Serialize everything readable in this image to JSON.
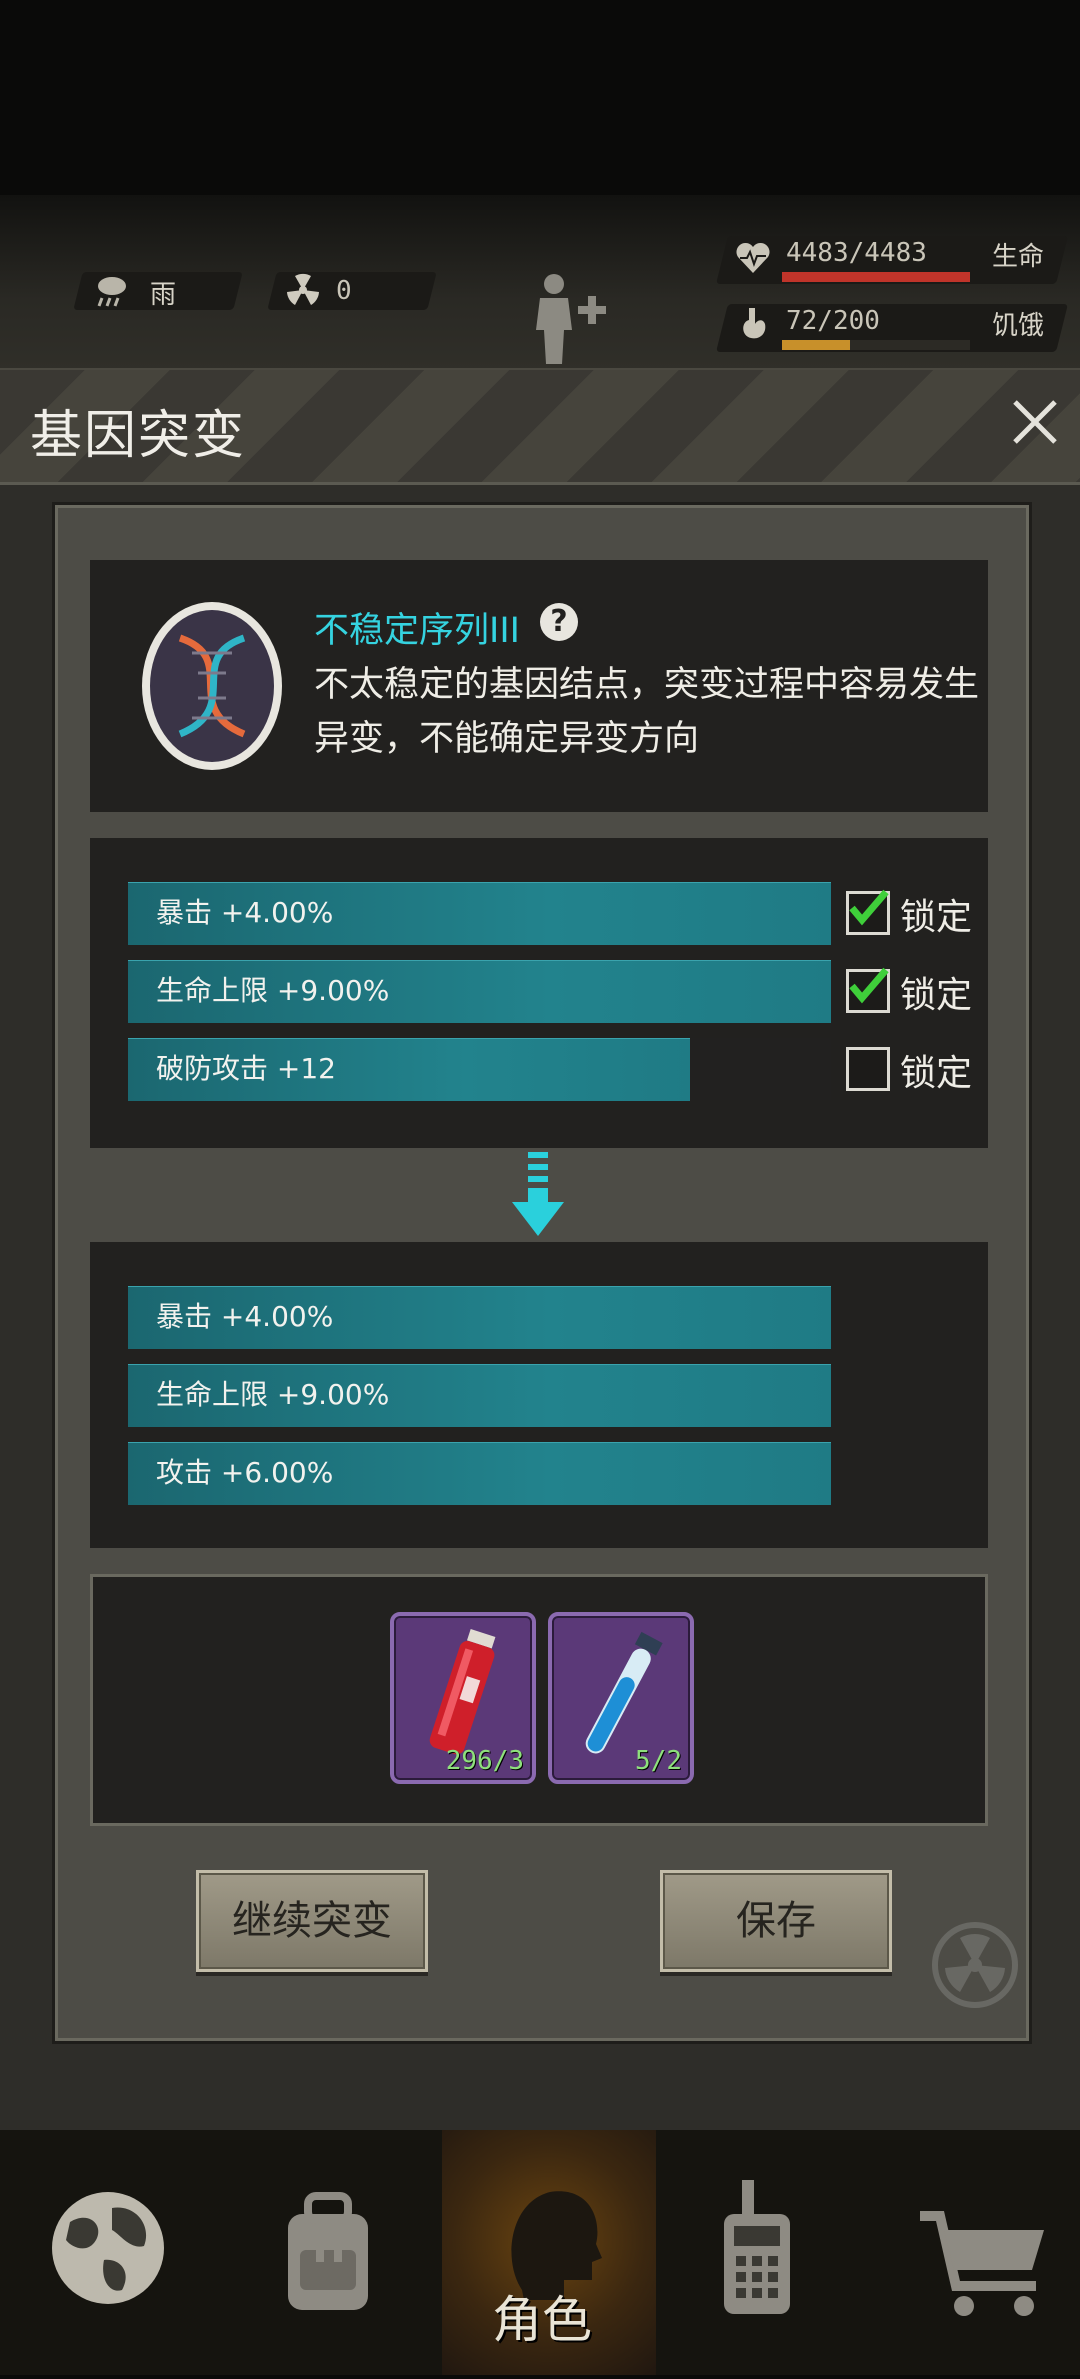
{
  "hud": {
    "weather_label": "雨",
    "weather_icon": "rain-cloud-icon",
    "radiation_value": "0",
    "radiation_icon": "radiation-icon",
    "health_text": "4483/4483",
    "health_label": "生命",
    "health_fraction": 1.0,
    "hunger_text": "72/200",
    "hunger_label": "饥饿",
    "hunger_fraction": 0.36,
    "colors": {
      "health": "#c0342a",
      "hunger": "#c8902a"
    }
  },
  "dialog": {
    "title": "基因突变",
    "gene": {
      "name": "不稳定序列III",
      "description": "不太稳定的基因结点，突变过程中容易发生异变，不能确定异变方向"
    },
    "current_stats": [
      {
        "text": "暴击 +4.00%",
        "fill": 1.0,
        "locked": true,
        "lock_label": "锁定"
      },
      {
        "text": "生命上限 +9.00%",
        "fill": 1.0,
        "locked": true,
        "lock_label": "锁定"
      },
      {
        "text": "破防攻击 +12",
        "fill": 0.8,
        "locked": false,
        "lock_label": "锁定"
      }
    ],
    "result_stats": [
      {
        "text": "暴击 +4.00%",
        "fill": 1.0
      },
      {
        "text": "生命上限 +9.00%",
        "fill": 1.0
      },
      {
        "text": "攻击 +6.00%",
        "fill": 1.0
      }
    ],
    "items": [
      {
        "name": "red-vial-icon",
        "count": "296/3"
      },
      {
        "name": "blue-test-tube-icon",
        "count": "5/2"
      }
    ],
    "continue_button": "继续突变",
    "save_button": "保存"
  },
  "nav": {
    "items": [
      {
        "icon": "globe-icon"
      },
      {
        "icon": "backpack-icon"
      },
      {
        "icon": "character-head-icon",
        "label": "角色",
        "active": true
      },
      {
        "icon": "walkie-talkie-icon"
      },
      {
        "icon": "shopping-cart-icon"
      }
    ]
  }
}
